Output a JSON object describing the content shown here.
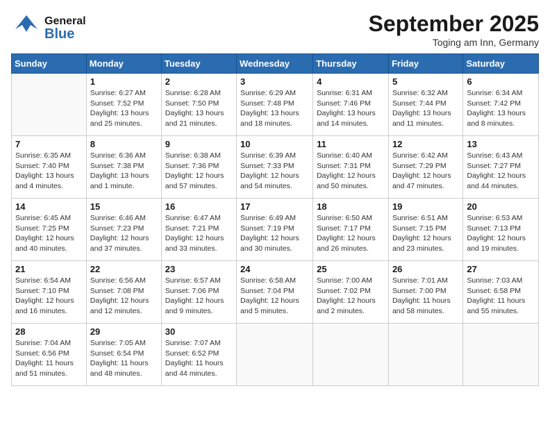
{
  "header": {
    "logo_general": "General",
    "logo_blue": "Blue",
    "title": "September 2025",
    "subtitle": "Toging am Inn, Germany"
  },
  "weekdays": [
    "Sunday",
    "Monday",
    "Tuesday",
    "Wednesday",
    "Thursday",
    "Friday",
    "Saturday"
  ],
  "weeks": [
    [
      {
        "day": "",
        "info": ""
      },
      {
        "day": "1",
        "info": "Sunrise: 6:27 AM\nSunset: 7:52 PM\nDaylight: 13 hours and 25 minutes."
      },
      {
        "day": "2",
        "info": "Sunrise: 6:28 AM\nSunset: 7:50 PM\nDaylight: 13 hours and 21 minutes."
      },
      {
        "day": "3",
        "info": "Sunrise: 6:29 AM\nSunset: 7:48 PM\nDaylight: 13 hours and 18 minutes."
      },
      {
        "day": "4",
        "info": "Sunrise: 6:31 AM\nSunset: 7:46 PM\nDaylight: 13 hours and 14 minutes."
      },
      {
        "day": "5",
        "info": "Sunrise: 6:32 AM\nSunset: 7:44 PM\nDaylight: 13 hours and 11 minutes."
      },
      {
        "day": "6",
        "info": "Sunrise: 6:34 AM\nSunset: 7:42 PM\nDaylight: 13 hours and 8 minutes."
      }
    ],
    [
      {
        "day": "7",
        "info": "Sunrise: 6:35 AM\nSunset: 7:40 PM\nDaylight: 13 hours and 4 minutes."
      },
      {
        "day": "8",
        "info": "Sunrise: 6:36 AM\nSunset: 7:38 PM\nDaylight: 13 hours and 1 minute."
      },
      {
        "day": "9",
        "info": "Sunrise: 6:38 AM\nSunset: 7:36 PM\nDaylight: 12 hours and 57 minutes."
      },
      {
        "day": "10",
        "info": "Sunrise: 6:39 AM\nSunset: 7:33 PM\nDaylight: 12 hours and 54 minutes."
      },
      {
        "day": "11",
        "info": "Sunrise: 6:40 AM\nSunset: 7:31 PM\nDaylight: 12 hours and 50 minutes."
      },
      {
        "day": "12",
        "info": "Sunrise: 6:42 AM\nSunset: 7:29 PM\nDaylight: 12 hours and 47 minutes."
      },
      {
        "day": "13",
        "info": "Sunrise: 6:43 AM\nSunset: 7:27 PM\nDaylight: 12 hours and 44 minutes."
      }
    ],
    [
      {
        "day": "14",
        "info": "Sunrise: 6:45 AM\nSunset: 7:25 PM\nDaylight: 12 hours and 40 minutes."
      },
      {
        "day": "15",
        "info": "Sunrise: 6:46 AM\nSunset: 7:23 PM\nDaylight: 12 hours and 37 minutes."
      },
      {
        "day": "16",
        "info": "Sunrise: 6:47 AM\nSunset: 7:21 PM\nDaylight: 12 hours and 33 minutes."
      },
      {
        "day": "17",
        "info": "Sunrise: 6:49 AM\nSunset: 7:19 PM\nDaylight: 12 hours and 30 minutes."
      },
      {
        "day": "18",
        "info": "Sunrise: 6:50 AM\nSunset: 7:17 PM\nDaylight: 12 hours and 26 minutes."
      },
      {
        "day": "19",
        "info": "Sunrise: 6:51 AM\nSunset: 7:15 PM\nDaylight: 12 hours and 23 minutes."
      },
      {
        "day": "20",
        "info": "Sunrise: 6:53 AM\nSunset: 7:13 PM\nDaylight: 12 hours and 19 minutes."
      }
    ],
    [
      {
        "day": "21",
        "info": "Sunrise: 6:54 AM\nSunset: 7:10 PM\nDaylight: 12 hours and 16 minutes."
      },
      {
        "day": "22",
        "info": "Sunrise: 6:56 AM\nSunset: 7:08 PM\nDaylight: 12 hours and 12 minutes."
      },
      {
        "day": "23",
        "info": "Sunrise: 6:57 AM\nSunset: 7:06 PM\nDaylight: 12 hours and 9 minutes."
      },
      {
        "day": "24",
        "info": "Sunrise: 6:58 AM\nSunset: 7:04 PM\nDaylight: 12 hours and 5 minutes."
      },
      {
        "day": "25",
        "info": "Sunrise: 7:00 AM\nSunset: 7:02 PM\nDaylight: 12 hours and 2 minutes."
      },
      {
        "day": "26",
        "info": "Sunrise: 7:01 AM\nSunset: 7:00 PM\nDaylight: 11 hours and 58 minutes."
      },
      {
        "day": "27",
        "info": "Sunrise: 7:03 AM\nSunset: 6:58 PM\nDaylight: 11 hours and 55 minutes."
      }
    ],
    [
      {
        "day": "28",
        "info": "Sunrise: 7:04 AM\nSunset: 6:56 PM\nDaylight: 11 hours and 51 minutes."
      },
      {
        "day": "29",
        "info": "Sunrise: 7:05 AM\nSunset: 6:54 PM\nDaylight: 11 hours and 48 minutes."
      },
      {
        "day": "30",
        "info": "Sunrise: 7:07 AM\nSunset: 6:52 PM\nDaylight: 11 hours and 44 minutes."
      },
      {
        "day": "",
        "info": ""
      },
      {
        "day": "",
        "info": ""
      },
      {
        "day": "",
        "info": ""
      },
      {
        "day": "",
        "info": ""
      }
    ]
  ]
}
